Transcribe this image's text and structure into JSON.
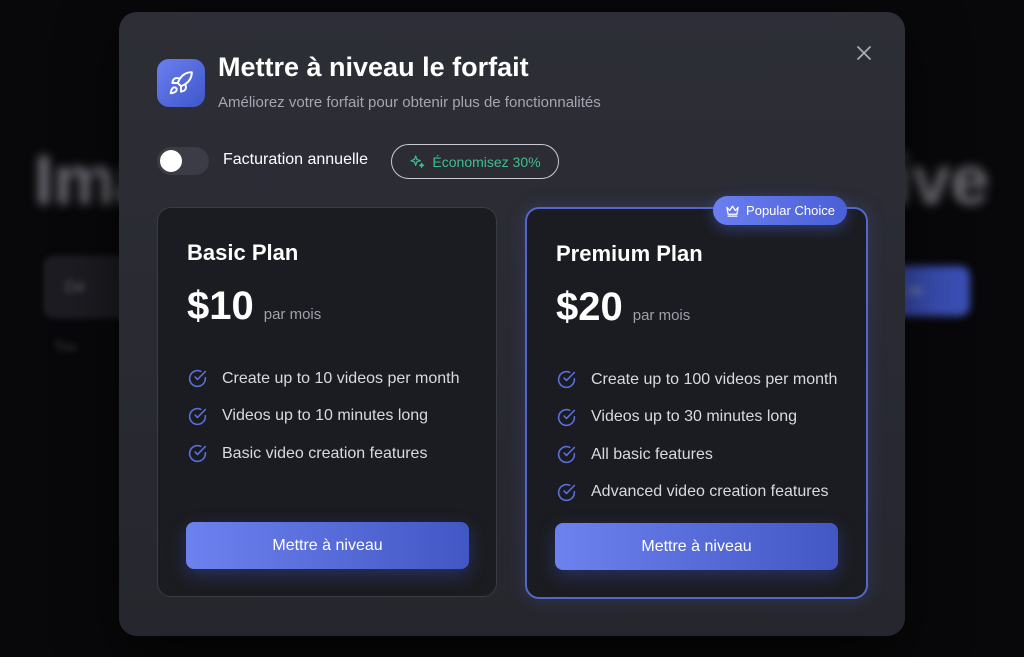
{
  "colors": {
    "accent": "#5466c9",
    "accent_light": "#6d82ee",
    "success": "#3fbf8f",
    "modal_bg": "#2d2e36",
    "card_bg": "#1b1c21"
  },
  "modal": {
    "title": "Mettre à niveau le forfait",
    "subtitle": "Améliorez votre forfait pour obtenir plus de fonctionnalités",
    "icon": "rocket-icon",
    "close_icon": "close-icon"
  },
  "billing": {
    "toggle_label": "Facturation annuelle",
    "toggle_on": false,
    "save_badge": "Économisez 30%",
    "save_icon": "sparkle-icon"
  },
  "plans": [
    {
      "name": "Basic Plan",
      "price": "$10",
      "period": "par mois",
      "features": [
        "Create up to 10 videos per month",
        "Videos up to 10 minutes long",
        "Basic video creation features"
      ],
      "button_label": "Mettre à niveau"
    },
    {
      "name": "Premium Plan",
      "price": "$20",
      "period": "par mois",
      "badge": "Popular Choice",
      "badge_icon": "crown-icon",
      "features": [
        "Create up to 100 videos per month",
        "Videos up to 30 minutes long",
        "All basic features",
        "Advanced video creation features"
      ],
      "button_label": "Mettre à niveau"
    }
  ],
  "background": {
    "title_left": "Ima",
    "title_right": "ive",
    "input_placeholder": "Dé",
    "button_label": "ra",
    "hint": "Tou"
  }
}
